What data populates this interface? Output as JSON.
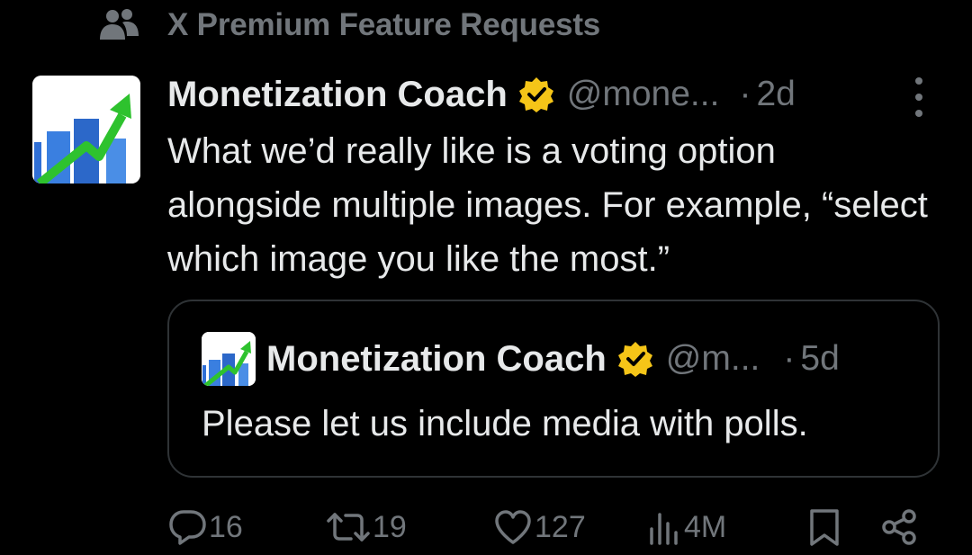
{
  "context": {
    "icon": "people-icon",
    "text": "X Premium Feature Requests"
  },
  "post": {
    "author": {
      "name": "Monetization Coach",
      "handle": "@mone...",
      "verified_badge": "verified-badge-icon",
      "badge_color": "#f5c518"
    },
    "separator": "·",
    "time": "2d",
    "text": "What we’d really like is a voting option alongside multiple images. For example, “select which image you like the most.”",
    "more_icon": "more-vertical-icon"
  },
  "quote": {
    "author": {
      "name": "Monetization Coach",
      "handle": "@m...",
      "verified_badge": "verified-badge-icon"
    },
    "separator": "·",
    "time": "5d",
    "text": "Please let us include media with polls."
  },
  "actions": {
    "reply": {
      "icon": "reply-icon",
      "count": "16"
    },
    "repost": {
      "icon": "repost-icon",
      "count": "19"
    },
    "like": {
      "icon": "like-icon",
      "count": "127"
    },
    "views": {
      "icon": "views-icon",
      "count": "4M"
    },
    "bookmark": {
      "icon": "bookmark-icon"
    },
    "share": {
      "icon": "share-icon"
    }
  },
  "colors": {
    "background": "#000000",
    "text": "#e7e9ea",
    "secondary": "#71767b",
    "border": "#2f3336",
    "badge": "#f5c518"
  }
}
